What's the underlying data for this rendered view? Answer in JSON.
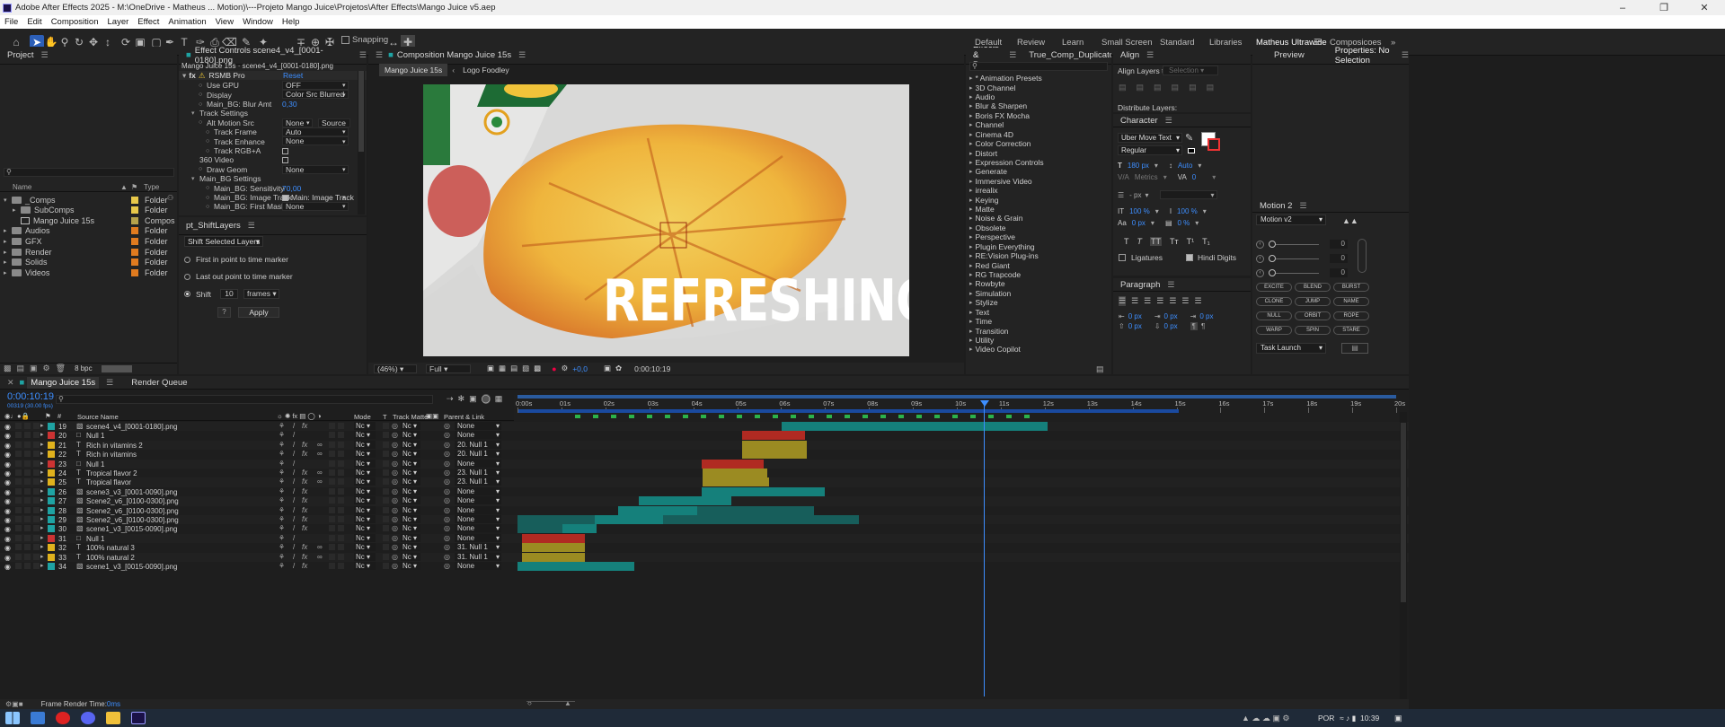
{
  "titlebar": {
    "title": "Adobe After Effects 2025 - M:\\OneDrive - Matheus ... Motion)\\---Projeto Mango Juice\\Projetos\\After Effects\\Mango Juice v5.aep"
  },
  "menu": [
    "File",
    "Edit",
    "Composition",
    "Layer",
    "Effect",
    "Animation",
    "View",
    "Window",
    "Help"
  ],
  "toolbar": {
    "snapping": "Snapping"
  },
  "workspaces": [
    "Default",
    "Review",
    "Learn",
    "Small Screen",
    "Standard",
    "Libraries",
    "Matheus Ultrawide",
    "Composicoes"
  ],
  "project": {
    "title": "Project",
    "search_placeholder": "",
    "col_name": "Name",
    "col_type": "Type",
    "items": [
      {
        "name": "_Comps",
        "type": "Folder",
        "color": "#e8c84a",
        "indent": 0,
        "open": true
      },
      {
        "name": "SubComps",
        "type": "Folder",
        "color": "#e8c84a",
        "indent": 1,
        "open": false
      },
      {
        "name": "Mango Juice 15s",
        "type": "Compos",
        "color": "#b6a24b",
        "indent": 1,
        "open": false
      },
      {
        "name": "Audios",
        "type": "Folder",
        "color": "#e07b1f",
        "indent": 0,
        "open": false
      },
      {
        "name": "GFX",
        "type": "Folder",
        "color": "#e07b1f",
        "indent": 0,
        "open": false
      },
      {
        "name": "Render",
        "type": "Folder",
        "color": "#e07b1f",
        "indent": 0,
        "open": false
      },
      {
        "name": "Solids",
        "type": "Folder",
        "color": "#e07b1f",
        "indent": 0,
        "open": false
      },
      {
        "name": "Videos",
        "type": "Folder",
        "color": "#e07b1f",
        "indent": 0,
        "open": false
      }
    ],
    "bpc": "8 bpc"
  },
  "effect_controls": {
    "title": "Effect Controls scene4_v4_[0001-0180].png",
    "subtitle": "Mango Juice 15s · scene4_v4_[0001-0180].png",
    "effect": "RSMB Pro",
    "reset": "Reset",
    "rows": [
      {
        "label": "Use GPU",
        "value": "OFF",
        "indent": 2
      },
      {
        "label": "Display",
        "value": "Color Src Blurred",
        "indent": 2
      },
      {
        "label": "Main_BG: Blur Amt",
        "value": "0,30",
        "indent": 2,
        "blue": true
      },
      {
        "label": "Track Settings",
        "value": "",
        "indent": 1
      },
      {
        "label": "Alt Motion Src",
        "value": "None",
        "indent": 2
      },
      {
        "label": "Track Frame",
        "value": "Auto",
        "indent": 3
      },
      {
        "label": "Track Enhance",
        "value": "None",
        "indent": 3
      },
      {
        "label": "Track RGB+A",
        "value": "",
        "indent": 3
      },
      {
        "label": "360 Video",
        "value": "",
        "indent": 1
      },
      {
        "label": "Draw Geom",
        "value": "None",
        "indent": 2
      },
      {
        "label": "Main_BG Settings",
        "value": "",
        "indent": 1
      },
      {
        "label": "Main_BG: Sensitivity",
        "value": "70,00",
        "indent": 3,
        "blue": true
      },
      {
        "label": "Main_BG: Image Track",
        "value": "Main: Image Track",
        "indent": 3
      },
      {
        "label": "Main_BG: First Mask",
        "value": "None",
        "indent": 3
      }
    ],
    "source_label": "Source"
  },
  "shift_layers": {
    "title": "pt_ShiftLayers",
    "mode": "Shift Selected Layers",
    "opt1": "First in point to time marker",
    "opt2": "Last out point to time marker",
    "opt3": "Shift",
    "shift_value": "10",
    "unit": "frames",
    "help": "?",
    "apply": "Apply"
  },
  "composition": {
    "title": "Composition Mango Juice 15s",
    "tabs": [
      "Mango Juice 15s",
      "Logo Foodley"
    ],
    "overlay_text": "REFRESHING",
    "zoom": "(46%)",
    "quality": "Full",
    "exposure": "+0,0",
    "timecode": "0:00:10:19"
  },
  "effects_presets": {
    "tabs": [
      "Effects & Presets",
      "True_Comp_Duplicator"
    ],
    "items": [
      "* Animation Presets",
      "3D Channel",
      "Audio",
      "Blur & Sharpen",
      "Boris FX Mocha",
      "Channel",
      "Cinema 4D",
      "Color Correction",
      "Distort",
      "Expression Controls",
      "Generate",
      "Immersive Video",
      "irrealix",
      "Keying",
      "Matte",
      "Noise & Grain",
      "Obsolete",
      "Perspective",
      "Plugin Everything",
      "RE:Vision Plug-ins",
      "Red Giant",
      "RG Trapcode",
      "Rowbyte",
      "Simulation",
      "Stylize",
      "Text",
      "Time",
      "Transition",
      "Utility",
      "Video Copilot"
    ]
  },
  "align": {
    "title": "Align",
    "align_to_label": "Align Layers to:",
    "align_to": "Selection",
    "distribute": "Distribute Layers:"
  },
  "character": {
    "title": "Character",
    "font": "Uber Move Text",
    "style": "Regular",
    "size": "180 px",
    "leading": "Auto",
    "kerning": "Metrics",
    "tracking": "0",
    "stroke": "- px",
    "vscale": "100 %",
    "hscale": "100 %",
    "baseline": "0 px",
    "tsume": "0 %",
    "ligatures": "Ligatures",
    "hindi": "Hindi Digits"
  },
  "paragraph": {
    "title": "Paragraph",
    "v1": "0 px",
    "v2": "0 px",
    "v3": "0 px",
    "v4": "0 px",
    "v5": "0 px"
  },
  "preview": {
    "tabs": [
      "Preview",
      "Properties: No Selection"
    ]
  },
  "motion2": {
    "title": "Motion 2",
    "mode": "Motion v2",
    "sliders": [
      "0",
      "0",
      "0"
    ],
    "buttons": [
      "EXCITE",
      "BLEND",
      "BURST",
      "CLONE",
      "JUMP",
      "NAME",
      "NULL",
      "ORBIT",
      "ROPE",
      "WARP",
      "SPIN",
      "STARE"
    ],
    "task": "Task Launch"
  },
  "timeline": {
    "tabs": [
      "Mango Juice 15s",
      "Render Queue"
    ],
    "timecode": "0:00:10:19",
    "timecode_sub": "00319 (30.00 fps)",
    "col_source": "Source Name",
    "col_mode": "Mode",
    "col_t": "T",
    "col_matte": "Track Matte",
    "col_parent": "Parent & Link",
    "ruler": [
      "0:00s",
      "01s",
      "02s",
      "03s",
      "04s",
      "05s",
      "06s",
      "07s",
      "08s",
      "09s",
      "10s",
      "11s",
      "12s",
      "13s",
      "14s",
      "15s",
      "16s",
      "17s",
      "18s",
      "19s",
      "20s"
    ],
    "layers": [
      {
        "num": "19",
        "color": "#1fa3a3",
        "name": "scene4_v4_[0001-0180].png",
        "kind": "img",
        "parent": "None"
      },
      {
        "num": "20",
        "color": "#c33",
        "name": "Null 1",
        "kind": "null",
        "parent": "None"
      },
      {
        "num": "21",
        "color": "#e0b21d",
        "name": "Rich in vitamins 2",
        "kind": "text",
        "parent": "20. Null 1"
      },
      {
        "num": "22",
        "color": "#e0b21d",
        "name": "Rich in vitamins",
        "kind": "text",
        "parent": "20. Null 1"
      },
      {
        "num": "23",
        "color": "#c33",
        "name": "Null 1",
        "kind": "null",
        "parent": "None"
      },
      {
        "num": "24",
        "color": "#e0b21d",
        "name": "Tropical flavor 2",
        "kind": "text",
        "parent": "23. Null 1"
      },
      {
        "num": "25",
        "color": "#e0b21d",
        "name": "Tropical flavor",
        "kind": "text",
        "parent": "23. Null 1"
      },
      {
        "num": "26",
        "color": "#1fa3a3",
        "name": "scene3_v3_[0001-0090].png",
        "kind": "img",
        "parent": "None"
      },
      {
        "num": "27",
        "color": "#1fa3a3",
        "name": "Scene2_v6_[0100-0300].png",
        "kind": "img",
        "parent": "None"
      },
      {
        "num": "28",
        "color": "#1fa3a3",
        "name": "Scene2_v6_[0100-0300].png",
        "kind": "img",
        "parent": "None"
      },
      {
        "num": "29",
        "color": "#1fa3a3",
        "name": "Scene2_v6_[0100-0300].png",
        "kind": "img",
        "parent": "None"
      },
      {
        "num": "30",
        "color": "#1fa3a3",
        "name": "scene1_v3_[0015-0090].png",
        "kind": "img",
        "parent": "None"
      },
      {
        "num": "31",
        "color": "#c33",
        "name": "Null 1",
        "kind": "null",
        "parent": "None"
      },
      {
        "num": "32",
        "color": "#e0b21d",
        "name": "100% natural 3",
        "kind": "text",
        "parent": "31. Null 1"
      },
      {
        "num": "33",
        "color": "#e0b21d",
        "name": "100% natural 2",
        "kind": "text",
        "parent": "31. Null 1"
      },
      {
        "num": "34",
        "color": "#1fa3a3",
        "name": "scene1_v3_[0015-0090].png",
        "kind": "img",
        "parent": "None"
      }
    ],
    "mode_value": "Nc",
    "matte_value": "Nc",
    "footer": "Frame Render Time: ",
    "footer_value": "0ms"
  },
  "taskbar": {
    "lang": "POR",
    "time": "10:39"
  }
}
